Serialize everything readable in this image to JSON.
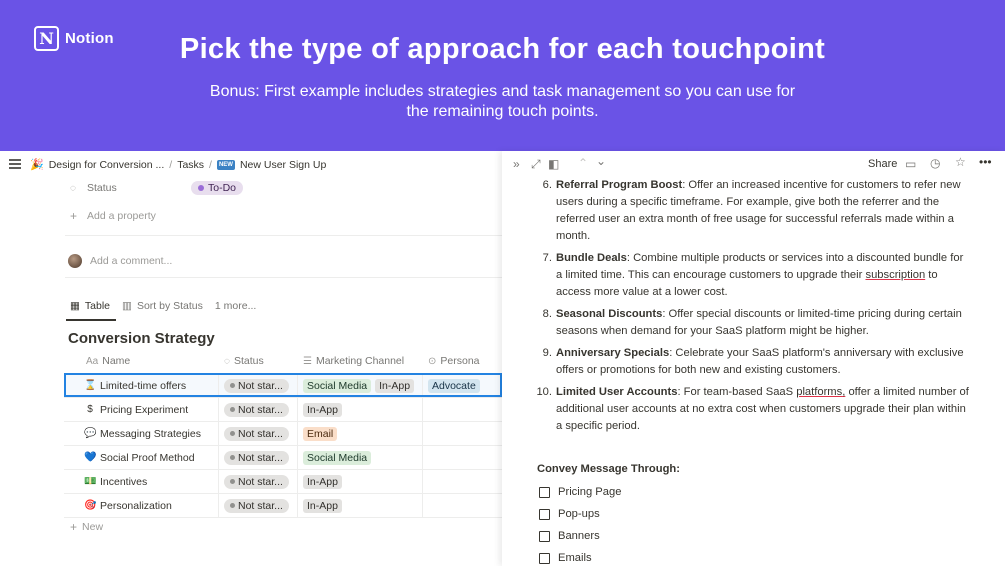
{
  "banner": {
    "brand": "Notion",
    "title": "Pick the type of approach for each touchpoint",
    "subtitle": "Bonus: First example includes strategies and task management so you can use for the remaining touch points."
  },
  "left": {
    "breadcrumb": {
      "root": "Design for Conversion ...",
      "sep1": "/",
      "tasks": "Tasks",
      "sep2": "/",
      "badge": "NEW",
      "page": "New User Sign Up"
    },
    "status_label": "Status",
    "status_value": "To-Do",
    "add_property": "Add a property",
    "add_comment": "Add a comment...",
    "views": {
      "table": "Table",
      "sort": "Sort by Status",
      "more": "1 more..."
    },
    "db_title": "Conversion Strategy",
    "columns": {
      "name_prefix": "Aa",
      "name": "Name",
      "status": "Status",
      "channel": "Marketing Channel",
      "persona": "Persona"
    },
    "rows": [
      {
        "icon": "⌛",
        "name": "Limited-time offers",
        "status": "Not star...",
        "channels": [
          "Social Media",
          "In-App"
        ],
        "persona": "Advocate"
      },
      {
        "icon": "$",
        "name": "Pricing Experiment",
        "status": "Not star...",
        "channels": [
          "In-App"
        ],
        "persona": ""
      },
      {
        "icon": "💬",
        "name": "Messaging Strategies",
        "status": "Not star...",
        "channels": [
          "Email"
        ],
        "persona": ""
      },
      {
        "icon": "💙",
        "name": "Social Proof Method",
        "status": "Not star...",
        "channels": [
          "Social Media"
        ],
        "persona": ""
      },
      {
        "icon": "💵",
        "name": "Incentives",
        "status": "Not star...",
        "channels": [
          "In-App"
        ],
        "persona": ""
      },
      {
        "icon": "🎯",
        "name": "Personalization",
        "status": "Not star...",
        "channels": [
          "In-App"
        ],
        "persona": ""
      }
    ],
    "new_label": "New"
  },
  "right": {
    "share": "Share",
    "items": [
      {
        "num": "6.",
        "title": "Referral Program Boost",
        "text": ": Offer an increased incentive for customers to refer new users during a specific timeframe. For example, give both the referrer and the referred user an extra month of free usage for successful referrals made within a month."
      },
      {
        "num": "7.",
        "title": "Bundle Deals",
        "text_a": ": Combine multiple products or services into a discounted bundle for a limited time. This can encourage customers to upgrade their ",
        "text_mark": "subscription",
        "text_b": " to access more value at a lower cost."
      },
      {
        "num": "8.",
        "title": "Seasonal Discounts",
        "text": ": Offer special discounts or limited-time pricing during certain seasons when demand for your SaaS platform might be higher."
      },
      {
        "num": "9.",
        "title": "Anniversary Specials",
        "text": ": Celebrate your SaaS platform's anniversary with exclusive offers or promotions for both new and existing customers."
      },
      {
        "num": "10.",
        "title": "Limited User Accounts",
        "text_a": ": For team-based SaaS ",
        "text_mark": "platforms,",
        "text_b": " offer a limited number of additional user accounts at no extra cost when customers upgrade their plan within a specific period."
      }
    ],
    "convey_heading": "Convey Message Through:",
    "todos": [
      "Pricing Page",
      "Pop-ups",
      "Banners",
      "Emails"
    ]
  }
}
